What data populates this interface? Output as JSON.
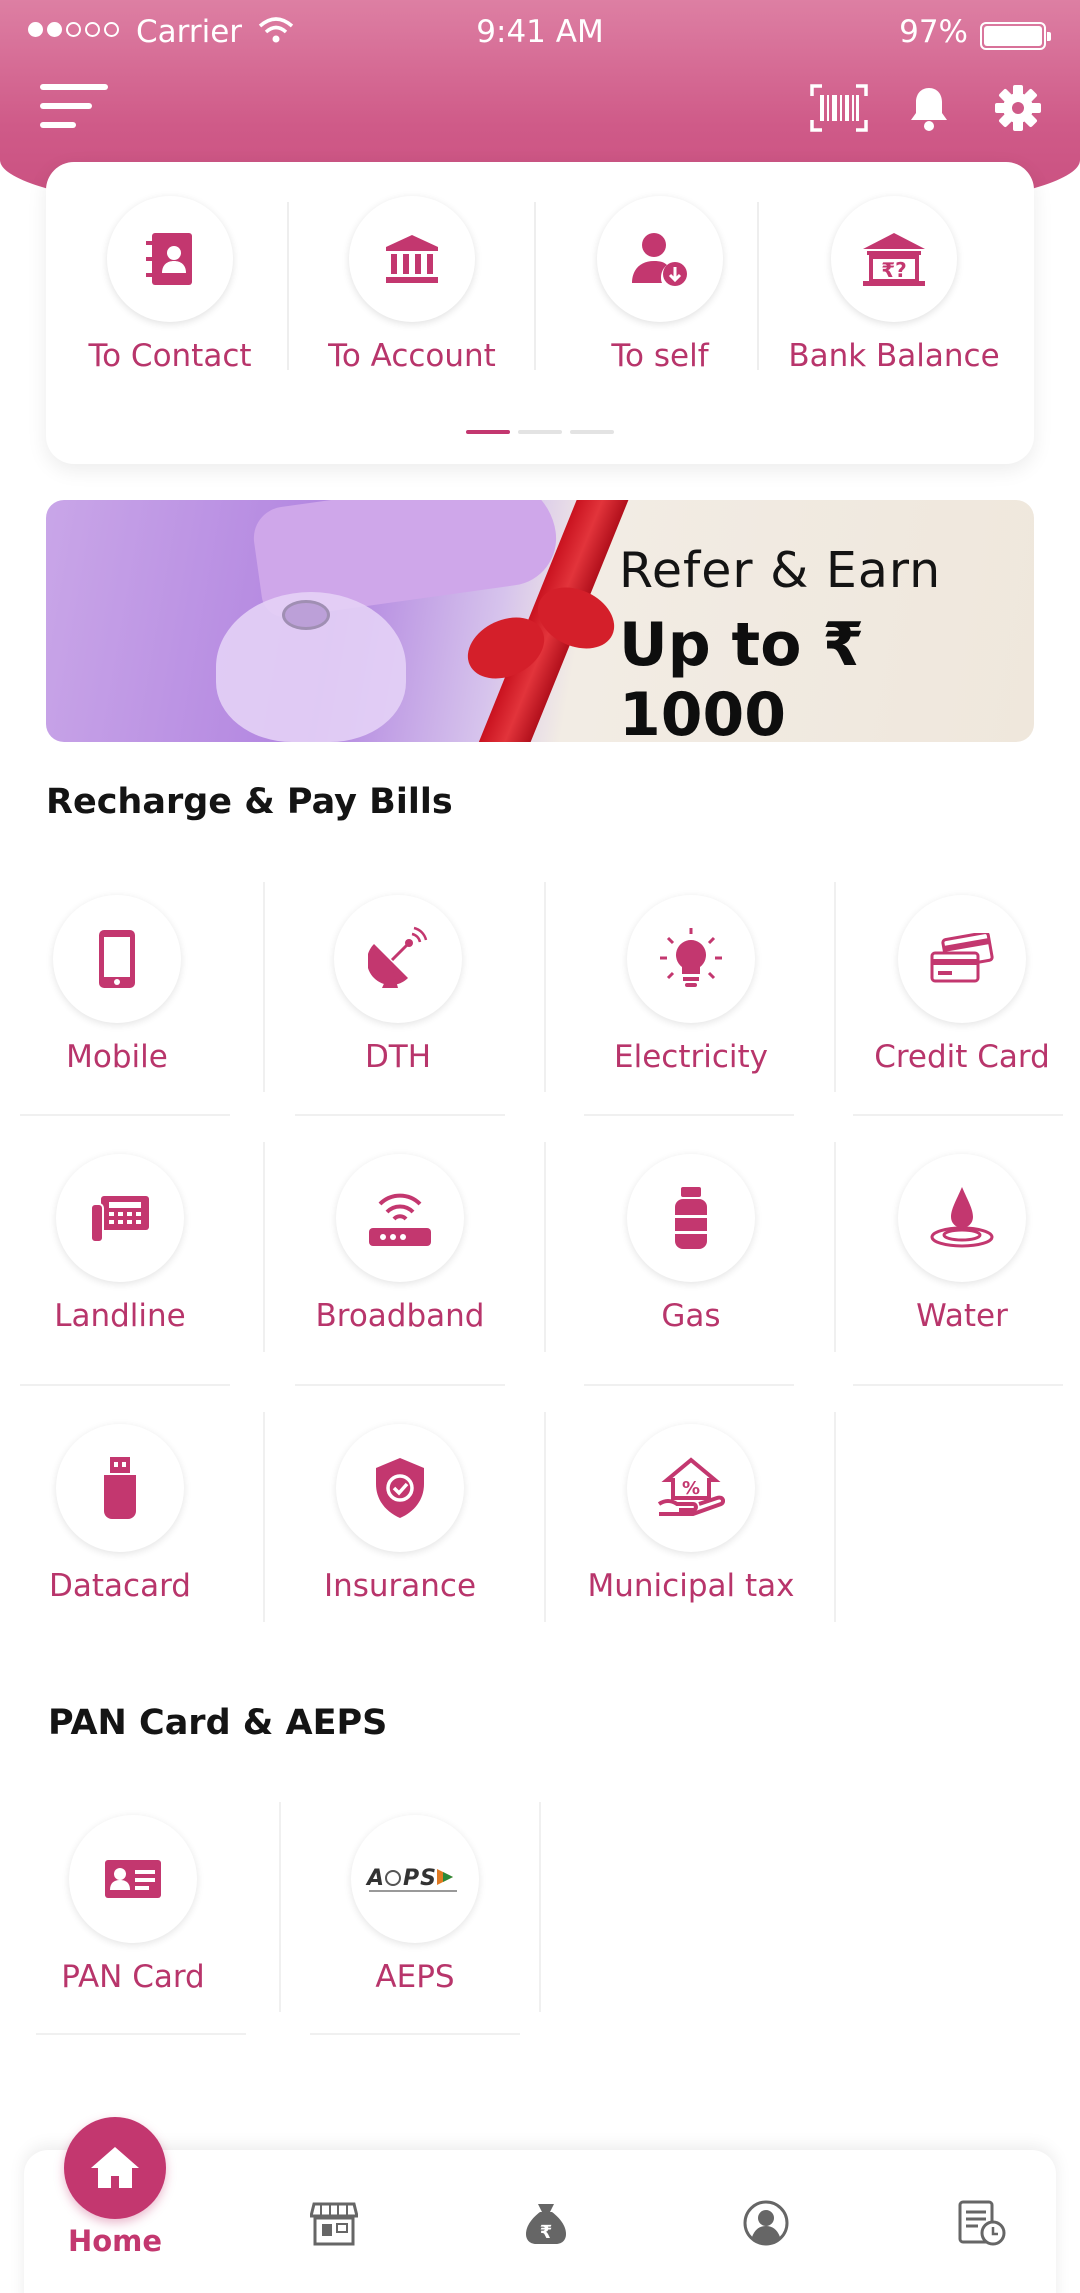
{
  "status_bar": {
    "carrier": "Carrier",
    "time": "9:41 AM",
    "battery": "97%"
  },
  "header": {
    "menu_icon": "hamburger-menu-icon",
    "barcode_icon": "barcode-scanner-icon",
    "bell_icon": "bell-icon",
    "gear_icon": "gear-icon"
  },
  "transfers": [
    {
      "label": "To Contact",
      "icon": "contact-book-icon"
    },
    {
      "label": "To Account",
      "icon": "bank-icon"
    },
    {
      "label": "To self",
      "icon": "user-download-icon"
    },
    {
      "label": "Bank Balance",
      "icon": "bank-balance-icon"
    }
  ],
  "banner": {
    "title": "Refer & Earn",
    "amount": "Up to ₹ 1000"
  },
  "recharge": {
    "title": "Recharge & Pay Bills",
    "items": [
      {
        "label": "Mobile",
        "icon": "mobile-icon"
      },
      {
        "label": "DTH",
        "icon": "satellite-dish-icon"
      },
      {
        "label": "Electricity",
        "icon": "bulb-icon"
      },
      {
        "label": "Credit Card",
        "icon": "credit-card-icon"
      },
      {
        "label": "Landline",
        "icon": "landline-phone-icon"
      },
      {
        "label": "Broadband",
        "icon": "router-icon"
      },
      {
        "label": "Gas",
        "icon": "gas-cylinder-icon"
      },
      {
        "label": "Water",
        "icon": "water-drop-icon"
      },
      {
        "label": "Datacard",
        "icon": "usb-dongle-icon"
      },
      {
        "label": "Insurance",
        "icon": "shield-check-icon"
      },
      {
        "label": "Municipal tax",
        "icon": "house-percent-icon"
      }
    ]
  },
  "pan_aeps": {
    "title": "PAN Card & AEPS",
    "items": [
      {
        "label": "PAN Card",
        "icon": "id-card-icon"
      },
      {
        "label": "AEPS",
        "icon": "aeps-logo-icon"
      }
    ]
  },
  "bottom_nav": {
    "home_label": "Home",
    "items": [
      "home-icon",
      "store-icon",
      "money-bag-icon",
      "profile-icon",
      "report-icon"
    ]
  },
  "colors": {
    "primary": "#c3376f",
    "label": "#b8356b",
    "header_top": "#dd7fa3",
    "header_bottom": "#c84d7e"
  }
}
